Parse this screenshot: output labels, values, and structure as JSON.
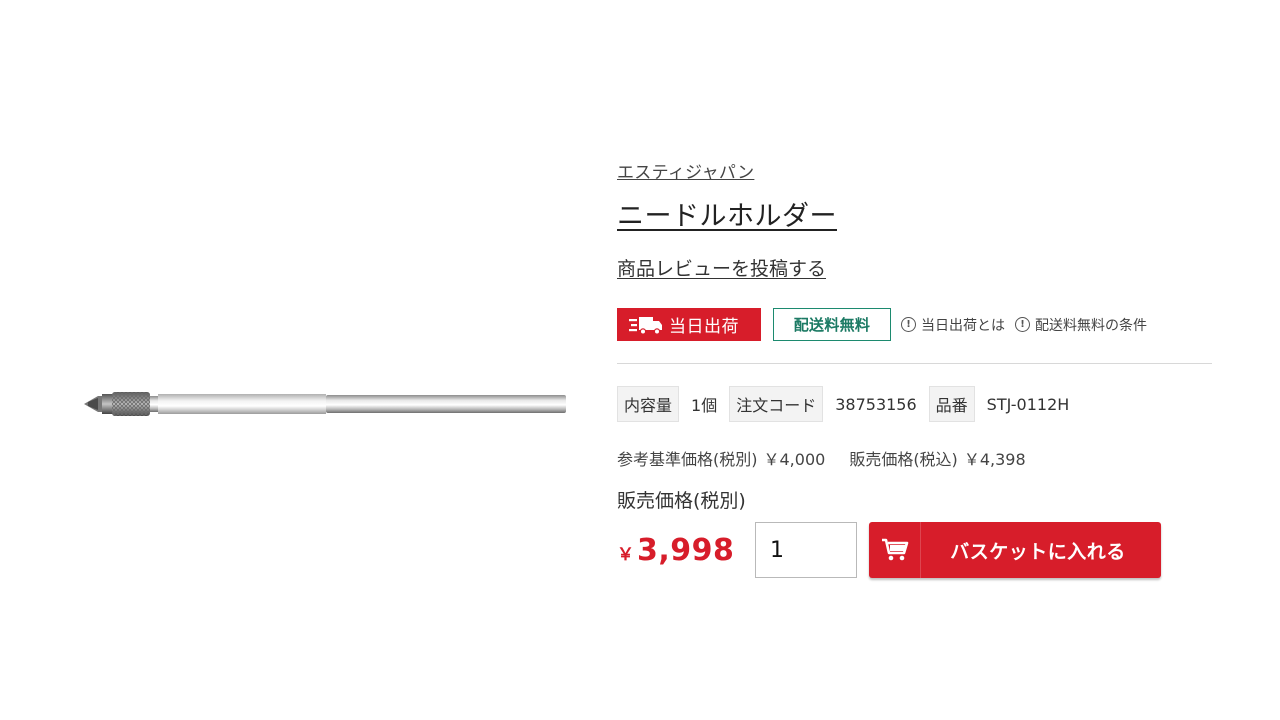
{
  "product": {
    "brand": "エスティジャパン",
    "title": "ニードルホルダー",
    "review_link": "商品レビューを投稿する",
    "image_alt": "needle-holder-tool-photo"
  },
  "badges": {
    "same_day": "当日出荷",
    "free_shipping": "配送料無料",
    "same_day_info": "当日出荷とは",
    "free_shipping_info": "配送料無料の条件"
  },
  "specs": [
    {
      "label": "内容量",
      "value": "1個"
    },
    {
      "label": "注文コード",
      "value": "38753156"
    },
    {
      "label": "品番",
      "value": "STJ-0112H"
    }
  ],
  "reference_prices": {
    "base_label": "参考基準価格(税別)",
    "base_value": "￥4,000",
    "sale_incl_label": "販売価格(税込)",
    "sale_incl_value": "￥4,398"
  },
  "price": {
    "label": "販売価格(税別)",
    "currency": "￥",
    "amount": "3,998"
  },
  "quantity": {
    "value": "1"
  },
  "cart": {
    "button_label": "バスケットに入れる"
  },
  "colors": {
    "accent_red": "#d71d2a",
    "free_shipping_green": "#1c8a6f"
  }
}
